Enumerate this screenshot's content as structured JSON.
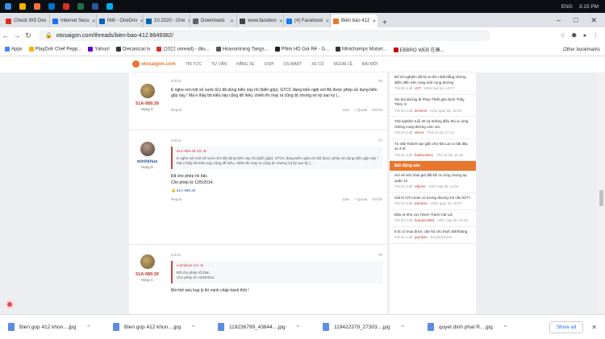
{
  "taskbar": {
    "lang": "ENG",
    "time": "3:15 PM"
  },
  "tabs": [
    {
      "label": "Check WS Dec",
      "color": "#d93025"
    },
    {
      "label": "Internet Secu",
      "color": "#1a73e8"
    },
    {
      "label": "NW - OneDriv",
      "color": "#0364b8"
    },
    {
      "label": "10.2020 - One",
      "color": "#0364b8"
    },
    {
      "label": "Downloads",
      "color": "#5f6368"
    },
    {
      "label": "www.faceboo",
      "color": "#444"
    },
    {
      "label": "(4) Facebook",
      "color": "#1877f2"
    },
    {
      "label": "Biến báo 412",
      "color": "#e8772e"
    }
  ],
  "address": {
    "url": "otosaigon.com/threads/bien-bao-412.8649382/"
  },
  "bookmarks": [
    "Apps",
    "PlayDoh Chef Pepp...",
    "Yahoo!",
    "Diecastcar.tv",
    "(1022 unread) - diiu...",
    "Hoasontrang Tangs...",
    "Phim HD Giá Rẻ - G...",
    "Minichamps Motorr...",
    "EBBRO WEB 在庫..."
  ],
  "bookmarks_other": "Other bookmarks",
  "site_nav": [
    "TIN TỨC",
    "TƯ VẤN",
    "HÃNG XE",
    "OSPI",
    "OS MART",
    "XE CŨ",
    "NGOÀI LỀ",
    "BÁI MỚI"
  ],
  "logo_text": "otosaigon.com",
  "posts": [
    {
      "date": "8/3/18",
      "num": "#6",
      "user": "51A-989.39",
      "rank": "Hạng C",
      "text": "E nghe nói một số nước EU đã dùng biển này rồi (biển gộp). GTCC đang kiến nghị với Bộ được phép sử dụng biển gộp này ! Mà e thấy bb kiểu này cũng dễ hiểu, chiến thì may ra cũng đc nhưng nó ký sao ký (..."
    },
    {
      "date": "8/3/18",
      "num": "#7",
      "user": "minhkhue",
      "rank": "Hạng D",
      "quote_head": "51A-989.39 nói: ⊕",
      "quote": "E nghe nói một số nước EU đã dùng biển này rồi (biển gộp). GTCC đang kiến nghị với Bộ được phép sử dụng biển gộp này ! Mà e thấy bb kiểu này cũng dễ hiểu, chiến thì may ra cũng đc nhưng nó ký sao ký (...",
      "line1": "Đã cho phép rồi bác.",
      "line2": "Cho phép từ 12/5/2014.",
      "likes": "51A-989.39"
    },
    {
      "date": "8/3/18",
      "num": "#8",
      "user": "51A-989.39",
      "rank": "Hạng C",
      "quote_head": "minhkhue nói: ⊕",
      "quote1": "Đã cho phép rồi bác.",
      "quote2": "Cho phép từ 12/5/2014.",
      "text": "Bởi thế nếu họp lý thì minh chấp hành thôi !"
    }
  ],
  "post_actions": {
    "report": "Report",
    "like": "Like",
    "quote": "+ Quote",
    "reply": "Trả lời"
  },
  "sidebar": {
    "items_top": [
      {
        "t": "Đồ tôi nghiệm đã lái xe lên nhất bằng những điểm đến trên cùng một cung đường",
        "m": "Trả lời cuối:",
        "u": "VAT",
        "d": "Hôm nay lúc 14:07"
      },
      {
        "t": "Xin hỏi đường đi Phan Thiết ghé Dinh Thầy Thím !!!",
        "m": "Trả lời cuối:",
        "u": "dickens",
        "d": "Hôm qua, lúc 10:30"
      },
      {
        "t": "Trải nghiệm tuổi 30 và những điều thú vị cùng những cung đường cảm xúc",
        "m": "Trả lời cuối:",
        "u": "simca",
        "d": "Thứ tư lúc 17:12"
      },
      {
        "t": "Tư vấn Khách sạn gần chợ Đà Lạt có bãi đậu xe 4 tớ",
        "m": "Trả lời cuối:",
        "u": "badmonkey",
        "d": "Thứ tư lúc 11:26"
      }
    ],
    "section": "Bất động sản",
    "items_bottom": [
      {
        "t": "Hỏi về việc khai giá đất khi ra công chứng tại quận 12",
        "m": "Trả lời cuối:",
        "u": "Stijnes",
        "d": "Hôm nay lúc 11:02"
      },
      {
        "t": "Giá trị OT,condo có tương đương với căn hộ??",
        "m": "Trả lời cuối:",
        "u": "pamkon",
        "d": "Hôm qua, lúc 20:07"
      },
      {
        "t": "Đầu tư khu vực Nhơn Trạch-Cát Lái",
        "m": "Trả lời cuối:",
        "u": "huyduc1983",
        "d": "Hôm nay lúc 13:44"
      },
      {
        "t": "8 tỏ có mua được căn hộ cho thuê 30tr/tháng",
        "m": "Trả lời cuối:",
        "u": "pamkon",
        "d": "53 phút trước"
      }
    ]
  },
  "downloads": [
    "Bien gop 412 khon....jpg",
    "Bien gop 412 khon....jpg",
    "119236799_43844....jpg",
    "119422379_27303....jpg",
    "quyet dinh phat R....jpg"
  ],
  "show_all": "Show all"
}
